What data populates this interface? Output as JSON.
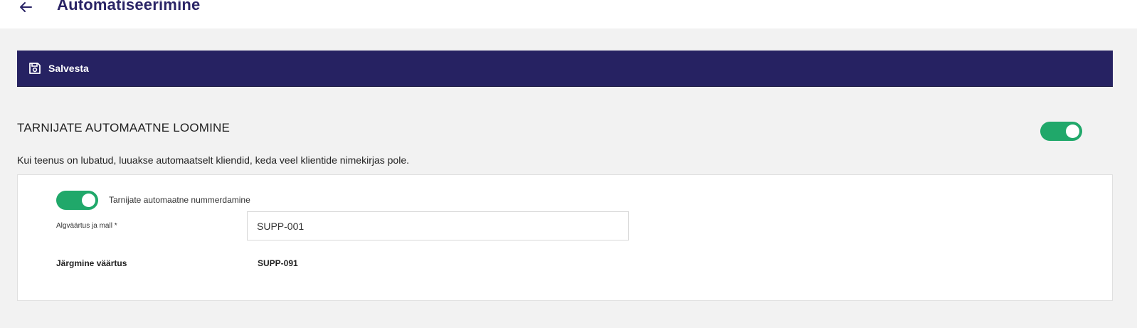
{
  "header": {
    "title": "Automatiseerimine",
    "back_icon": "arrow-left-icon"
  },
  "toolbar": {
    "save_label": "Salvesta",
    "save_icon": "floppy-disk-icon",
    "background": "#262262"
  },
  "section": {
    "title": "TARNIJATE AUTOMAATNE LOOMINE",
    "enabled": true,
    "description": "Kui teenus on lubatud, luuakse automaatselt kliendid, keda veel klientide nimekirjas pole."
  },
  "numbering": {
    "toggle_label": "Tarnijate automaatne nummerdamine",
    "enabled": true,
    "start_label": "Algväärtus ja mall *",
    "start_value": "SUPP-001",
    "next_label": "Järgmine väärtus",
    "next_value": "SUPP-091"
  },
  "colors": {
    "accent": "#2a2466",
    "toggle_on": "#20a86a",
    "background": "#f2f2f2"
  }
}
